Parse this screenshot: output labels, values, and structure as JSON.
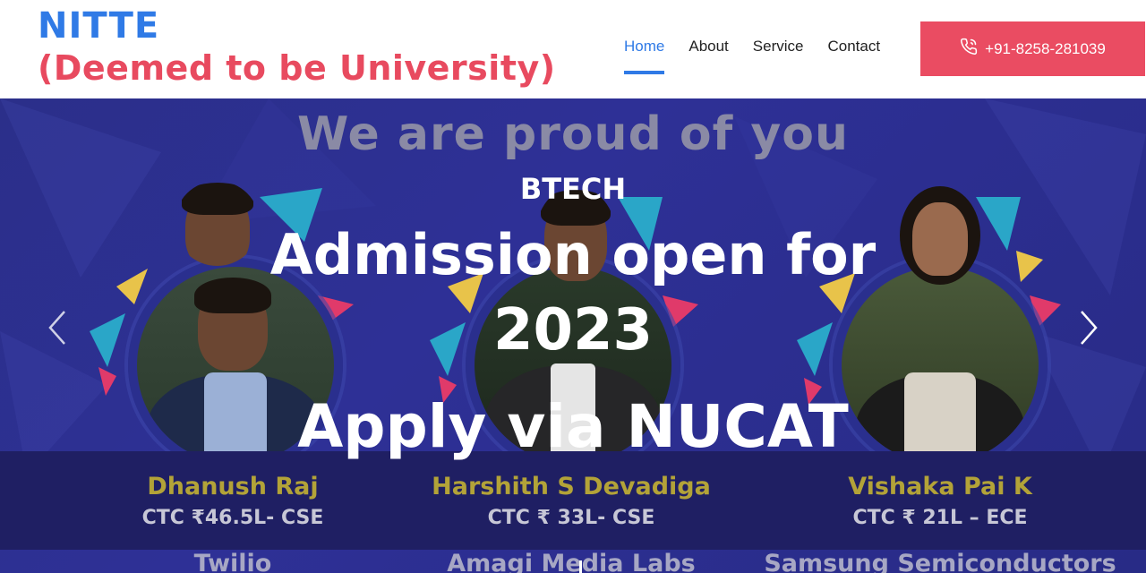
{
  "brand": {
    "name": "NITTE",
    "subtitle": "(Deemed to be University)"
  },
  "nav": {
    "items": [
      "Home",
      "About",
      "Service",
      "Contact"
    ],
    "active": "Home"
  },
  "phone": {
    "number": "+91-8258-281039",
    "icon": "phone-icon"
  },
  "hero": {
    "banner_heading": "We are proud of you",
    "overlay": {
      "program": "BTECH",
      "line1": "Admission open for",
      "line2": "2023",
      "line3": "Apply via NUCAT"
    },
    "students": [
      {
        "name": "Dhanush Raj",
        "ctc": "CTC ₹46.5L- CSE",
        "company": "Twilio"
      },
      {
        "name": "Harshith S Devadiga",
        "ctc": "CTC ₹ 33L- CSE",
        "company": "Amagi Media Labs"
      },
      {
        "name": "Vishaka Pai K",
        "ctc": "CTC ₹ 21L – ECE",
        "company": "Samsung Semiconductors"
      }
    ],
    "prev_icon": "chevron-left-icon",
    "next_icon": "chevron-right-icon"
  },
  "colors": {
    "brand_blue": "#2f7ae6",
    "accent_red": "#ea4c62",
    "hero_bg": "#2b2f8a",
    "name_gold": "#b3a338"
  }
}
